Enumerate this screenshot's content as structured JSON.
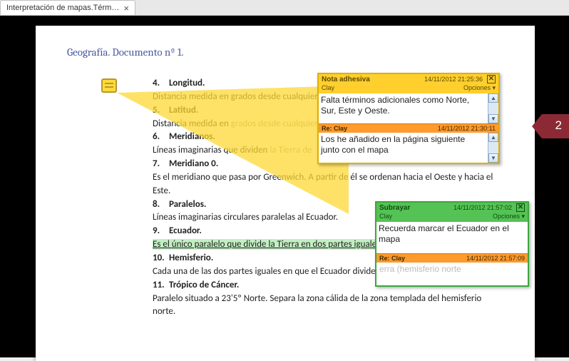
{
  "tab": {
    "title": "Interpretación de mapas.Términos ..."
  },
  "doc": {
    "title": "Geografía. Documento nº 1.",
    "items": [
      {
        "n": "4.",
        "h": "Longitud.",
        "p": "Distancia medida en grados desde cualquier",
        "gray": false
      },
      {
        "n": "5.",
        "h": "Latitud.",
        "p": "Distancia medida en ",
        "gray": "grados desde cualquier"
      },
      {
        "n": "6.",
        "h": "Meridianos.",
        "p": "Líneas imaginarias que dividen ",
        "gray": "la Tierra de"
      },
      {
        "n": "7.",
        "h": "Meridiano 0.",
        "p": "Es el meridiano que pasa por Greenwich. A partir de él se ordenan hacia el Oeste y hacia el Este."
      },
      {
        "n": "8.",
        "h": "Paralelos.",
        "p": "Líneas imaginarias circulares paralelas al Ecuador."
      },
      {
        "n": "9.",
        "h": "Ecuador.",
        "p": "Es el único paralelo que divide la Tierra en dos partes iguales.",
        "ul": true
      },
      {
        "n": "10.",
        "h": "Hemisferio.",
        "p": "Cada una de las dos partes iguales en que el Ecuador divide la y hemisferio sur)."
      },
      {
        "n": "11.",
        "h": "Trópico de Cáncer.",
        "p": "Paralelo situado a 23'5º Norte. Separa la zona cálida de la zona templada del hemisferio norte."
      }
    ]
  },
  "callout": {
    "count": "2"
  },
  "sticky": {
    "type": "Nota adhesiva",
    "date": "14/11/2012 21:25:36",
    "author": "Clay",
    "options": "Opciones",
    "msg": "Falta términos adicionales como Norte, Sur, Este y Oeste.",
    "reply_author": "Re: Clay",
    "reply_date": "14/11/2012 21:30:11",
    "reply_msg": "Los he añadido en la página siguiente junto con el mapa"
  },
  "highlight": {
    "type": "Subrayar",
    "date": "14/11/2012 21:57:02",
    "author": "Clay",
    "options": "Opciones",
    "msg": "Recuerda marcar el Ecuador en el mapa",
    "reply_author": "Re: Clay",
    "reply_date": "14/11/2012 21:57:09",
    "reply_placeholder": "erra (hemisferio norte"
  }
}
